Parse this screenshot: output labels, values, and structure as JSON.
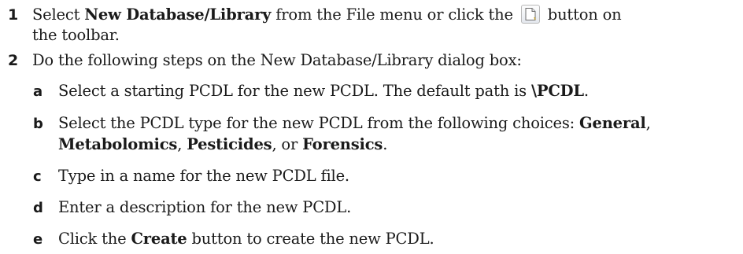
{
  "steps": [
    {
      "number": "1",
      "line1_select": "Select ",
      "line1_bold": "New Database/Library",
      "line1_mid": " from the File menu or click the ",
      "line1_end": " button on",
      "line2": "the toolbar."
    },
    {
      "number": "2",
      "text": "Do the following steps on the New Database/Library dialog box:",
      "substeps": [
        {
          "letter": "a",
          "pre": "Select a starting PCDL for the new PCDL. The default path is ",
          "bold": "\\PCDL",
          "post": "."
        },
        {
          "letter": "b",
          "pre": "Select the PCDL type for the new PCDL from the following choices: ",
          "bold1": "General",
          "sep1": ",",
          "bold2": "Metabolomics",
          "sep2": ", ",
          "bold3": "Pesticides",
          "sep3": ", or ",
          "bold4": "Forensics",
          "post": "."
        },
        {
          "letter": "c",
          "text": "Type in a name for the new PCDL file."
        },
        {
          "letter": "d",
          "text": "Enter a description for the new PCDL."
        },
        {
          "letter": "e",
          "pre": "Click the ",
          "bold": "Create",
          "post": " button to create the new PCDL."
        }
      ]
    }
  ],
  "icons": {
    "new_document_button": "new-document-icon",
    "accent": "#c9a227"
  }
}
